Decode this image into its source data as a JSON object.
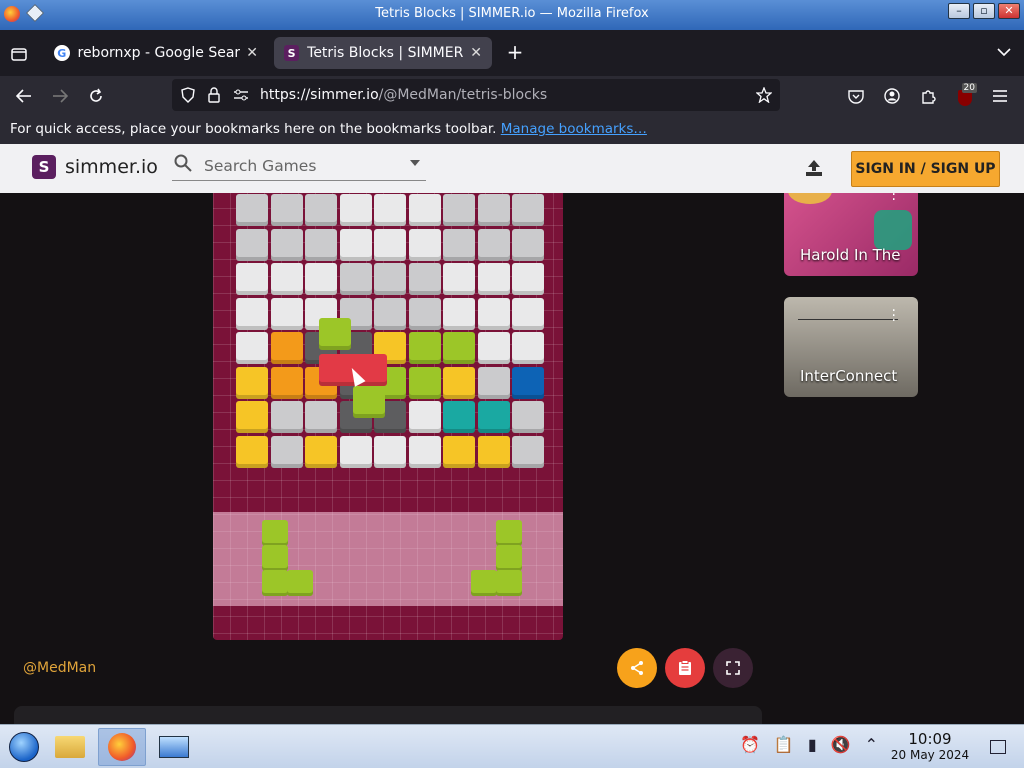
{
  "window": {
    "title": "Tetris Blocks | SIMMER.io — Mozilla Firefox",
    "minimize": "–",
    "maximize": "▫",
    "close": "✕"
  },
  "tabs": [
    {
      "label": "rebornxp - Google Search",
      "active": false
    },
    {
      "label": "Tetris Blocks | SIMMER.io",
      "active": true
    }
  ],
  "tab_close": "✕",
  "new_tab": "+",
  "nav": {
    "url_host": "https://simmer.io",
    "url_path": "/@MedMan/tetris-blocks",
    "extension_badge": "20"
  },
  "bookmarks_bar": {
    "message": "For quick access, place your bookmarks here on the bookmarks toolbar.",
    "link": "Manage bookmarks…"
  },
  "site": {
    "logo_letter": "S",
    "logo_text": "simmer.io",
    "search_placeholder": "Search Games",
    "signin_label": "SIGN IN / SIGN UP",
    "author": "@MedMan"
  },
  "colors": {
    "gray": "#cbcbcd",
    "white": "#e9e9ea",
    "orange": "#f39a1a",
    "yellow": "#f6c526",
    "green": "#9cc628",
    "red": "#e23a46",
    "teal": "#1aa9a2",
    "blue": "#0d63b5",
    "dark": "#5d5d5f"
  },
  "board": {
    "rows": [
      [
        "gray",
        "gray",
        "gray",
        "white",
        "white",
        "white",
        "gray",
        "gray",
        "gray"
      ],
      [
        "gray",
        "gray",
        "gray",
        "white",
        "white",
        "white",
        "gray",
        "gray",
        "gray"
      ],
      [
        "white",
        "white",
        "white",
        "gray",
        "gray",
        "gray",
        "white",
        "white",
        "white"
      ],
      [
        "white",
        "white",
        "white",
        "gray",
        "gray",
        "gray",
        "white",
        "white",
        "white"
      ],
      [
        "white",
        "orange",
        "dark",
        "dark",
        "yellow",
        "green",
        "green",
        "white",
        "white"
      ],
      [
        "yellow",
        "orange",
        "orange",
        "dark",
        "green",
        "green",
        "yellow",
        "gray",
        "blue"
      ],
      [
        "yellow",
        "gray",
        "gray",
        "dark",
        "dark",
        "white",
        "teal",
        "teal",
        "gray"
      ],
      [
        "yellow",
        "gray",
        "yellow",
        "white",
        "white",
        "white",
        "yellow",
        "yellow",
        "gray"
      ]
    ]
  },
  "sidebar_cards": [
    {
      "title": "Harold In The"
    },
    {
      "title": "InterConnect"
    }
  ],
  "taskbar": {
    "time": "10:09",
    "date": "20 May 2024"
  }
}
